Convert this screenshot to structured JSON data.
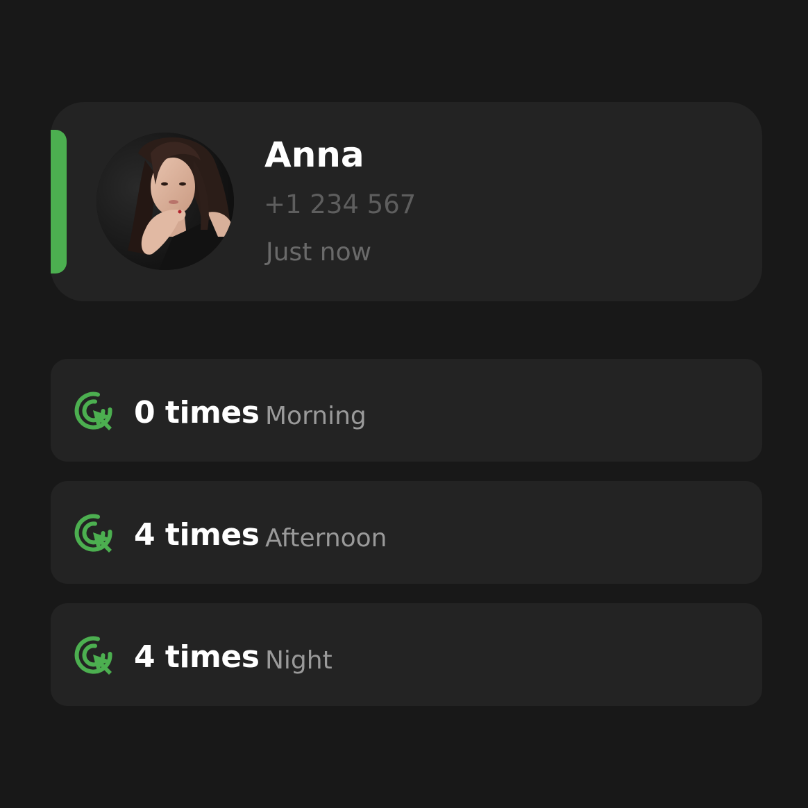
{
  "contact": {
    "name": "Anna",
    "phone": "+1 234 567",
    "last_seen": "Just now",
    "accent_color": "#4caf50",
    "avatar": "profile-photo"
  },
  "stats": [
    {
      "count": "0 times",
      "period": "Morning",
      "icon": "click-icon"
    },
    {
      "count": "4 times",
      "period": "Afternoon",
      "icon": "click-icon"
    },
    {
      "count": "4 times",
      "period": "Night",
      "icon": "click-icon"
    }
  ],
  "colors": {
    "background": "#181818",
    "card": "#232323",
    "accent": "#4caf50"
  }
}
